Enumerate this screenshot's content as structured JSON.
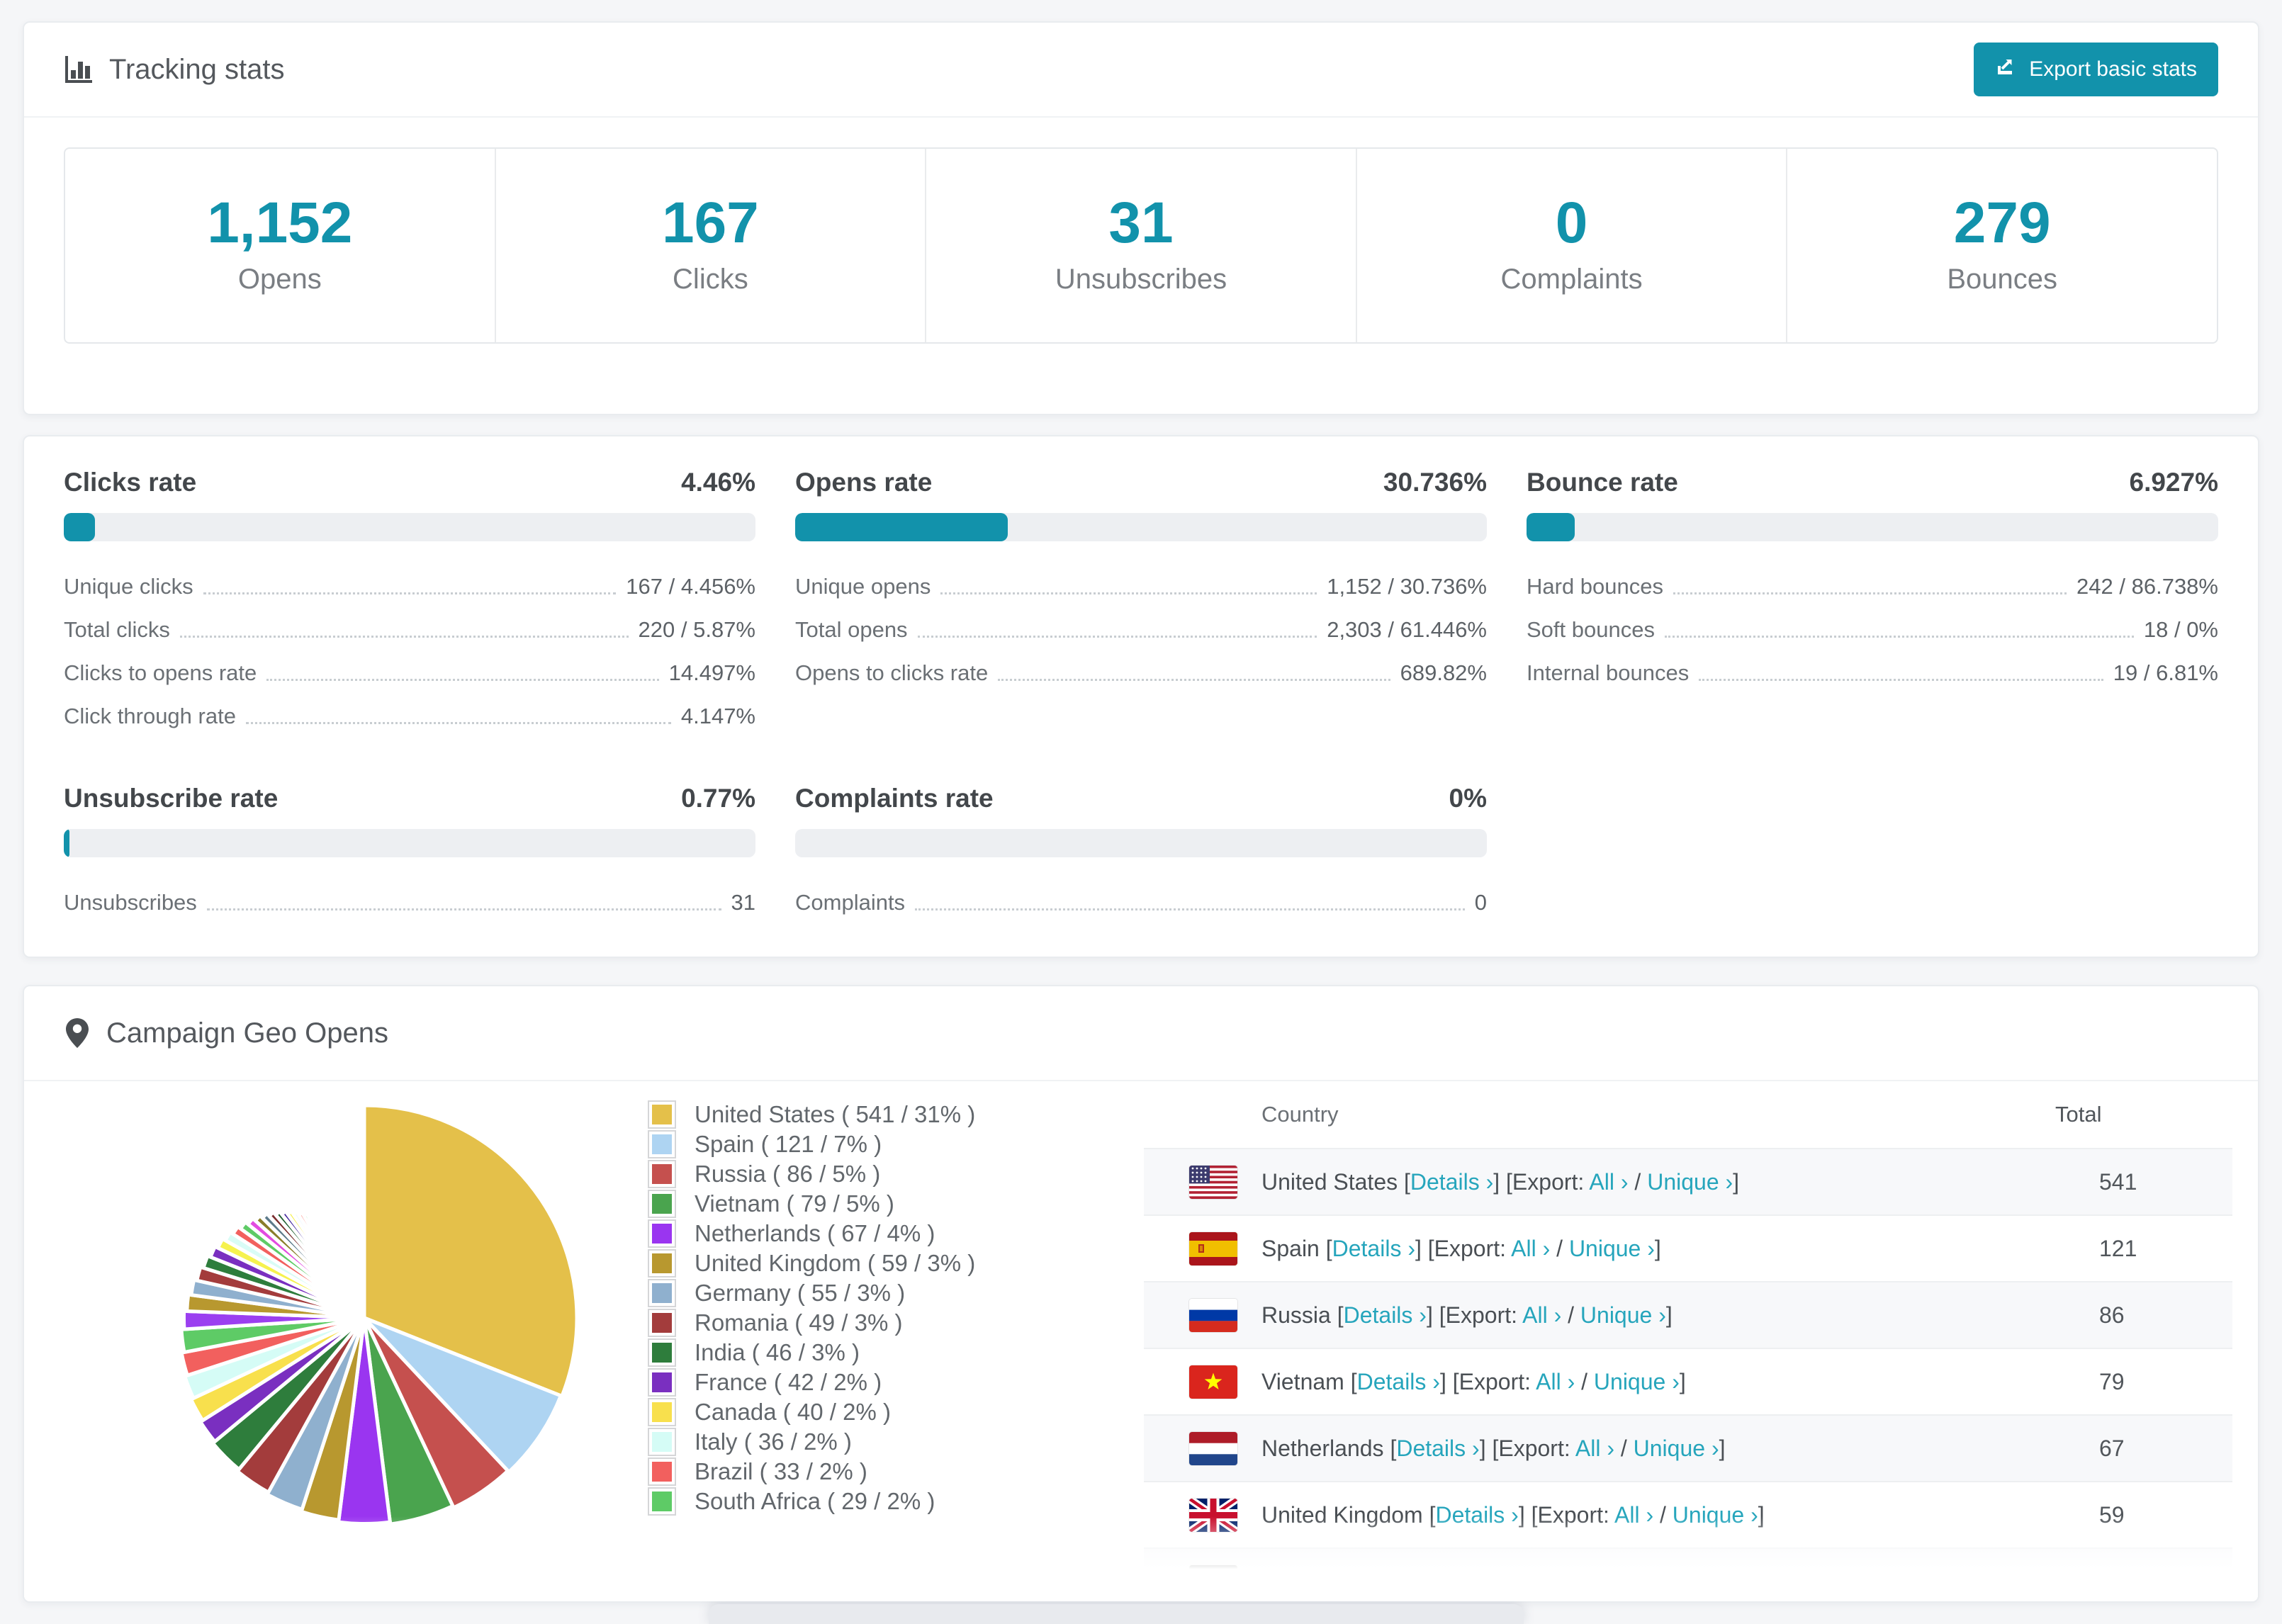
{
  "tracking": {
    "title": "Tracking stats",
    "export_button": "Export basic stats",
    "cards": [
      {
        "value": "1,152",
        "label": "Opens"
      },
      {
        "value": "167",
        "label": "Clicks"
      },
      {
        "value": "31",
        "label": "Unsubscribes"
      },
      {
        "value": "0",
        "label": "Complaints"
      },
      {
        "value": "279",
        "label": "Bounces"
      }
    ]
  },
  "rates": {
    "clicks": {
      "title": "Clicks rate",
      "value": "4.46%",
      "percent": 4.46,
      "rows": [
        {
          "label": "Unique clicks",
          "value": "167 / 4.456%"
        },
        {
          "label": "Total clicks",
          "value": "220 / 5.87%"
        },
        {
          "label": "Clicks to opens rate",
          "value": "14.497%"
        },
        {
          "label": "Click through rate",
          "value": "4.147%"
        }
      ]
    },
    "opens": {
      "title": "Opens rate",
      "value": "30.736%",
      "percent": 30.736,
      "rows": [
        {
          "label": "Unique opens",
          "value": "1,152 / 30.736%"
        },
        {
          "label": "Total opens",
          "value": "2,303 / 61.446%"
        },
        {
          "label": "Opens to clicks rate",
          "value": "689.82%"
        }
      ]
    },
    "bounce": {
      "title": "Bounce rate",
      "value": "6.927%",
      "percent": 6.927,
      "rows": [
        {
          "label": "Hard bounces",
          "value": "242 / 86.738%"
        },
        {
          "label": "Soft bounces",
          "value": "18 / 0%"
        },
        {
          "label": "Internal bounces",
          "value": "19 / 6.81%"
        }
      ]
    },
    "unsubscribe": {
      "title": "Unsubscribe rate",
      "value": "0.77%",
      "percent": 0.77,
      "rows": [
        {
          "label": "Unsubscribes",
          "value": "31"
        }
      ]
    },
    "complaints": {
      "title": "Complaints rate",
      "value": "0%",
      "percent": 0,
      "rows": [
        {
          "label": "Complaints",
          "value": "0"
        }
      ]
    }
  },
  "geo": {
    "title": "Campaign Geo Opens",
    "legend": [
      {
        "label": "United States ( 541 / 31% )",
        "color": "#e4c04a"
      },
      {
        "label": "Spain ( 121 / 7% )",
        "color": "#aed4f2"
      },
      {
        "label": "Russia ( 86 / 5% )",
        "color": "#c5504e"
      },
      {
        "label": "Vietnam ( 79 / 5% )",
        "color": "#4aa44e"
      },
      {
        "label": "Netherlands ( 67 / 4% )",
        "color": "#9a35f0"
      },
      {
        "label": "United Kingdom ( 59 / 3% )",
        "color": "#b8982f"
      },
      {
        "label": "Germany ( 55 / 3% )",
        "color": "#8fb0ce"
      },
      {
        "label": "Romania ( 49 / 3% )",
        "color": "#a33c3c"
      },
      {
        "label": "India ( 46 / 3% )",
        "color": "#2e7d3c"
      },
      {
        "label": "France ( 42 / 2% )",
        "color": "#7a2fc0"
      },
      {
        "label": "Canada ( 40 / 2% )",
        "color": "#f8e04d"
      },
      {
        "label": "Italy ( 36 / 2% )",
        "color": "#d5fcf6"
      },
      {
        "label": "Brazil ( 33 / 2% )",
        "color": "#f2605e"
      },
      {
        "label": "South Africa ( 29 / 2% )",
        "color": "#5ecb66"
      }
    ],
    "table": {
      "headers": {
        "country": "Country",
        "total": "Total"
      },
      "link_parts": {
        "lb": " [",
        "details": "Details ›",
        "mid": "] [Export: ",
        "all": "All ›",
        "slash": " / ",
        "unique": "Unique ›",
        "rb": "]"
      },
      "rows": [
        {
          "country": "United States",
          "flag": "us",
          "total": "541"
        },
        {
          "country": "Spain",
          "flag": "es",
          "total": "121"
        },
        {
          "country": "Russia",
          "flag": "ru",
          "total": "86"
        },
        {
          "country": "Vietnam",
          "flag": "vn",
          "total": "79"
        },
        {
          "country": "Netherlands",
          "flag": "nl",
          "total": "67"
        },
        {
          "country": "United Kingdom",
          "flag": "gb",
          "total": "59"
        }
      ],
      "partial_row": {
        "flag": "de"
      }
    }
  },
  "chart_data": {
    "type": "pie",
    "title": "Campaign Geo Opens",
    "legend_position": "right",
    "start_angle_deg": -90,
    "direction": "clockwise",
    "slices": [
      {
        "label": "United States",
        "value": 541,
        "percent": 31,
        "color": "#e4c04a"
      },
      {
        "label": "Spain",
        "value": 121,
        "percent": 7,
        "color": "#aed4f2"
      },
      {
        "label": "Russia",
        "value": 86,
        "percent": 5,
        "color": "#c5504e"
      },
      {
        "label": "Vietnam",
        "value": 79,
        "percent": 5,
        "color": "#4aa44e"
      },
      {
        "label": "Netherlands",
        "value": 67,
        "percent": 4,
        "color": "#9a35f0"
      },
      {
        "label": "United Kingdom",
        "value": 59,
        "percent": 3,
        "color": "#b8982f"
      },
      {
        "label": "Germany",
        "value": 55,
        "percent": 3,
        "color": "#8fb0ce"
      },
      {
        "label": "Romania",
        "value": 49,
        "percent": 3,
        "color": "#a33c3c"
      },
      {
        "label": "India",
        "value": 46,
        "percent": 3,
        "color": "#2e7d3c"
      },
      {
        "label": "France",
        "value": 42,
        "percent": 2,
        "color": "#7a2fc0"
      },
      {
        "label": "Canada",
        "value": 40,
        "percent": 2,
        "color": "#f8e04d"
      },
      {
        "label": "Italy",
        "value": 36,
        "percent": 2,
        "color": "#d5fcf6"
      },
      {
        "label": "Brazil",
        "value": 33,
        "percent": 2,
        "color": "#f2605e"
      },
      {
        "label": "South Africa",
        "value": 29,
        "percent": 2,
        "color": "#5ecb66"
      }
    ],
    "others": {
      "description": "unlabeled long tail of smaller countries rendered as progressively shorter slices",
      "percents": [
        1.6,
        1.5,
        1.4,
        1.3,
        1.2,
        1.1,
        1.0,
        0.95,
        0.9,
        0.85,
        0.8,
        0.75,
        0.7,
        0.65,
        0.6,
        0.58,
        0.56,
        0.54,
        0.52,
        0.5,
        0.48,
        0.46,
        0.44,
        0.42,
        0.4,
        0.38,
        0.36,
        0.34,
        0.32,
        0.3,
        0.28,
        0.26,
        0.24,
        0.22,
        0.2,
        0.18,
        0.16,
        0.14,
        0.12,
        0.1
      ],
      "colors": [
        "#9b3ff0",
        "#b8982f",
        "#8fb0ce",
        "#a33c3c",
        "#2e7d3c",
        "#7a2fc0",
        "#f6f24e",
        "#d9fcf6",
        "#f2605e",
        "#5ecb66",
        "#e24be0",
        "#8a7d2a",
        "#5c7a8a",
        "#7a2e2e",
        "#1f5e2f",
        "#40249c",
        "#f4ef4a",
        "#e6f6ff",
        "#fa7a72",
        "#49d45c",
        "#cc44ee",
        "#c9a227",
        "#a9cdeb",
        "#d94343",
        "#3fae4c",
        "#9b4dee",
        "#d4a82c",
        "#7d9db5",
        "#8b3a3a",
        "#1f6b35",
        "#5b2d9e",
        "#f7ef4a",
        "#bfeef7",
        "#ff8072",
        "#39c24d",
        "#e040fb",
        "#96862c",
        "#6b8ea3",
        "#9e3535",
        "#8d35e8"
      ]
    }
  }
}
